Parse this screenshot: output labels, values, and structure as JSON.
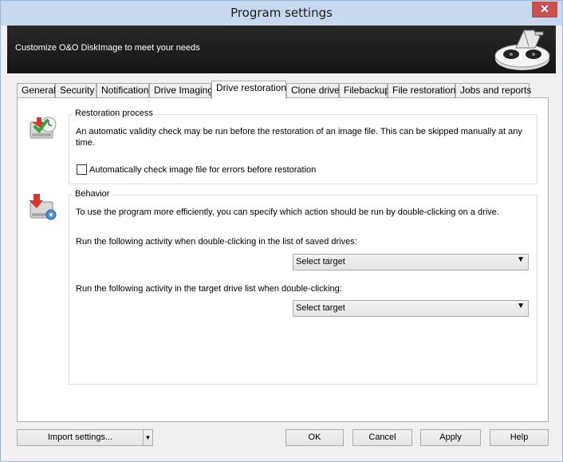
{
  "window": {
    "title": "Program settings",
    "close_label": "✕"
  },
  "banner": {
    "text": "Customize O&O DiskImage to meet your needs"
  },
  "tabs": [
    {
      "label": "General"
    },
    {
      "label": "Security"
    },
    {
      "label": "Notification"
    },
    {
      "label": "Drive Imaging"
    },
    {
      "label": "Drive restoration"
    },
    {
      "label": "Clone drive"
    },
    {
      "label": "Filebackup"
    },
    {
      "label": "File restoration"
    },
    {
      "label": "Jobs and reports"
    }
  ],
  "restoration": {
    "title": "Restoration process",
    "description": "An automatic validity check may be run before the restoration of an image file. This can be skipped manually at any time.",
    "checkbox_label": "Automatically check image file for errors before restoration",
    "checkbox_checked": false
  },
  "behavior": {
    "title": "Behavior",
    "description": "To use the program more efficiently, you can specify which action should be run by double-clicking on a drive.",
    "saved_drives_label": "Run the following activity when double-clicking in the list of saved drives:",
    "saved_drives_value": "Select target",
    "target_drive_label": "Run the following activity in the target drive list when double-clicking:",
    "target_drive_value": "Select target"
  },
  "footer": {
    "import_label": "Import settings...",
    "ok_label": "OK",
    "cancel_label": "Cancel",
    "apply_label": "Apply",
    "help_label": "Help"
  },
  "icons": {
    "restoration": "drive-restore-check-icon",
    "behavior": "drive-restore-settings-icon"
  }
}
